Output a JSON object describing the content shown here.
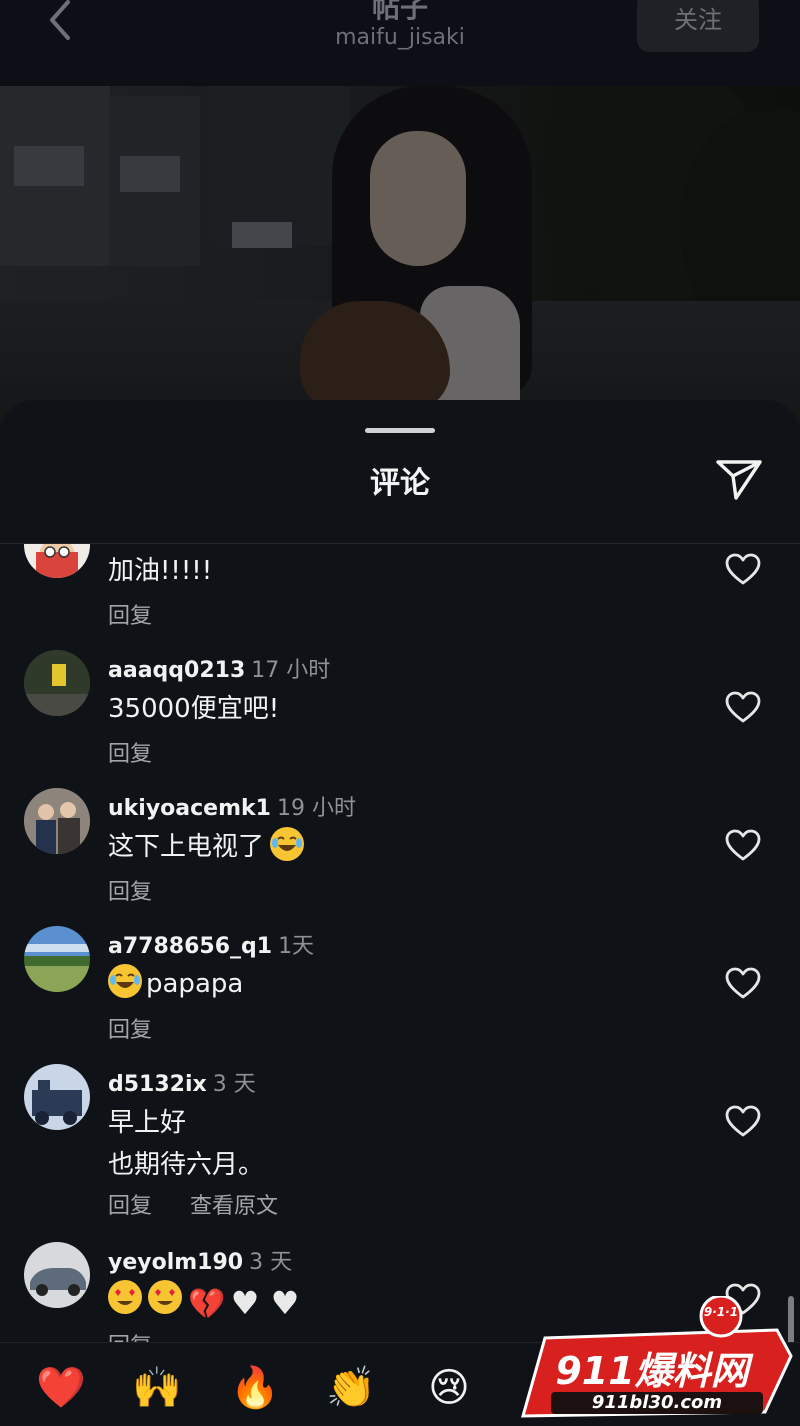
{
  "header": {
    "title": "帖子",
    "username": "maifu_jisaki",
    "follow_label": "关注"
  },
  "sheet": {
    "title": "评论"
  },
  "comments": [
    {
      "username": "",
      "time": "",
      "text": "加油!!!!!",
      "reply_label": "回复"
    },
    {
      "username": "aaaqq0213",
      "time": "17 小时",
      "text": "35000便宜吧!",
      "reply_label": "回复"
    },
    {
      "username": "ukiyoacemk1",
      "time": "19 小时",
      "text": "这下上电视了",
      "reply_label": "回复"
    },
    {
      "username": "a7788656_q1",
      "time": "1天",
      "text": "papapa",
      "reply_label": "回复"
    },
    {
      "username": "d5132ix",
      "time": "3 天",
      "text_line1": "早上好",
      "text_line2": "也期待六月。",
      "reply_label": "回复",
      "see_original_label": "查看原文"
    },
    {
      "username": "yeyolm190",
      "time": "3 天",
      "reply_label": "回复"
    }
  ],
  "reactions": [
    "❤️",
    "🙌",
    "🔥",
    "👏",
    "😢"
  ],
  "watermark": {
    "badge": "9·1·1",
    "brand": "911爆料网",
    "url": "911bl30.com"
  },
  "icons": {
    "back": "chevron-left-icon",
    "share": "paper-plane-icon",
    "like": "heart-outline-icon"
  },
  "colors": {
    "background": "#0f1318",
    "text": "#f2f2f2",
    "muted": "#8e9196",
    "watermark_red": "#d8201f"
  }
}
